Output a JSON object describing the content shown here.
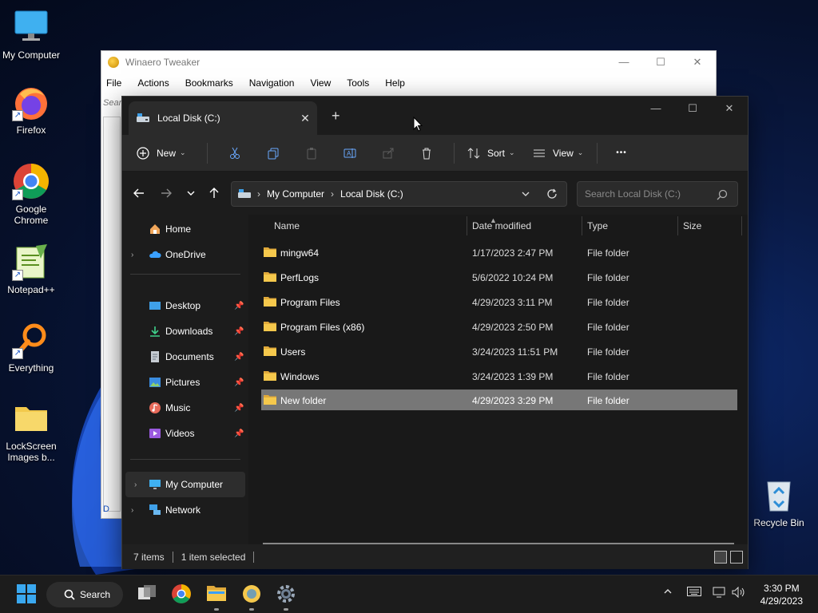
{
  "desktop": {
    "icons": [
      {
        "label": "My Computer"
      },
      {
        "label": "Firefox"
      },
      {
        "label": "Google Chrome"
      },
      {
        "label": "Notepad++"
      },
      {
        "label": "Everything"
      },
      {
        "label": "LockScreen Images b..."
      },
      {
        "label": "Recycle Bin"
      }
    ]
  },
  "winaero": {
    "title": "Winaero Tweaker",
    "menu": [
      "File",
      "Actions",
      "Bookmarks",
      "Navigation",
      "View",
      "Tools",
      "Help"
    ],
    "search_stub": "Sear",
    "bottom_stub": "D"
  },
  "explorer": {
    "tab_title": "Local Disk (C:)",
    "toolbar": {
      "new_label": "New",
      "sort_label": "Sort",
      "view_label": "View",
      "more_label": "•••"
    },
    "breadcrumb": [
      "My Computer",
      "Local Disk (C:)"
    ],
    "search_placeholder": "Search Local Disk (C:)",
    "nav": {
      "home": "Home",
      "onedrive": "OneDrive",
      "desktop": "Desktop",
      "downloads": "Downloads",
      "documents": "Documents",
      "pictures": "Pictures",
      "music": "Music",
      "videos": "Videos",
      "mycomputer": "My Computer",
      "network": "Network"
    },
    "columns": {
      "name": "Name",
      "date": "Date modified",
      "type": "Type",
      "size": "Size"
    },
    "files": [
      {
        "name": "mingw64",
        "date": "1/17/2023 2:47 PM",
        "type": "File folder"
      },
      {
        "name": "PerfLogs",
        "date": "5/6/2022 10:24 PM",
        "type": "File folder"
      },
      {
        "name": "Program Files",
        "date": "4/29/2023 3:11 PM",
        "type": "File folder"
      },
      {
        "name": "Program Files (x86)",
        "date": "4/29/2023 2:50 PM",
        "type": "File folder"
      },
      {
        "name": "Users",
        "date": "3/24/2023 11:51 PM",
        "type": "File folder"
      },
      {
        "name": "Windows",
        "date": "3/24/2023 1:39 PM",
        "type": "File folder"
      },
      {
        "name": "New folder",
        "date": "4/29/2023 3:29 PM",
        "type": "File folder"
      }
    ],
    "status": {
      "items": "7 items",
      "selected": "1 item selected"
    }
  },
  "taskbar": {
    "search_label": "Search",
    "time": "3:30 PM",
    "date": "4/29/2023"
  },
  "colors": {
    "accent": "#0078d4",
    "folder": "#f2c94c",
    "selection": "#777777"
  }
}
